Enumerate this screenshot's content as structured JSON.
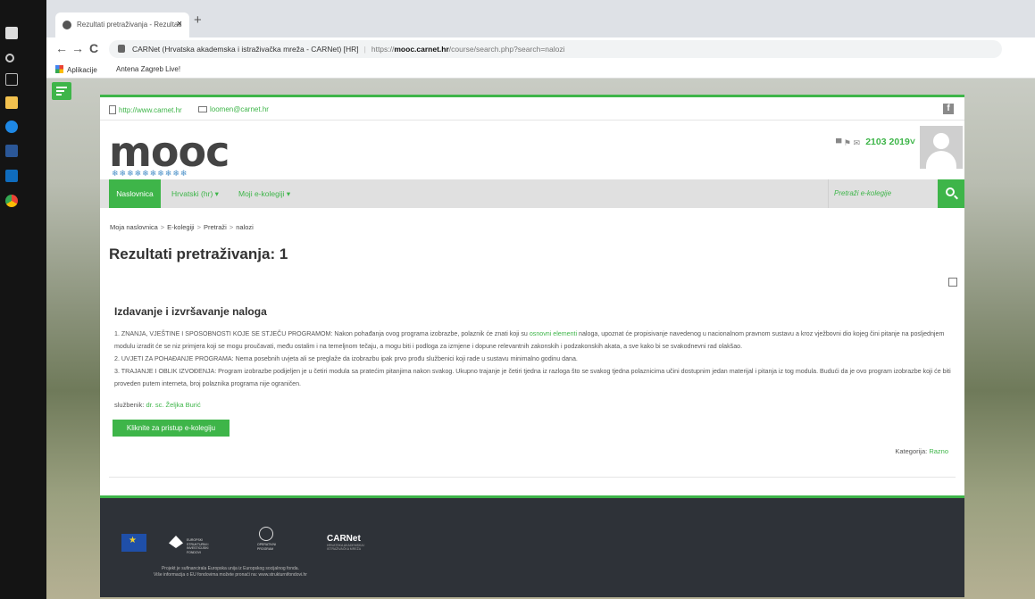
{
  "browser": {
    "tab_title": "Rezultati pretraživanja - Rezultati",
    "tab_close": "×",
    "new_tab": "+",
    "nav_back": "←",
    "nav_forward": "→",
    "nav_reload": "C",
    "site_identity": "CARNet (Hrvatska akademska i istraživačka mreža - CARNet) [HR]",
    "url_prefix": "https://",
    "url_host": "mooc.carnet.hr",
    "url_path": "/course/search.php?search=nalozi",
    "bookmarks": [
      "Aplikacije",
      "Antena Zagreb Live!"
    ]
  },
  "topbar": {
    "website": "http://www.carnet.hr",
    "email": "loomen@carnet.hr",
    "facebook_label": "f"
  },
  "logo": {
    "text": "mooc",
    "dots": "❄❄❄❄❄❄❄❄❄❄"
  },
  "user": {
    "icons": "▀  ⚑  ✉",
    "name": "2103 2019˅"
  },
  "nav": {
    "home": "Naslovnica",
    "language": "Hrvatski (hr) ▾",
    "my_courses": "Moji e-kolegiji ▾",
    "search_placeholder": "Pretraži e-kolegije"
  },
  "breadcrumb": [
    "Moja naslovnica",
    "E-kolegiji",
    "Pretraži",
    "nalozi"
  ],
  "breadcrumb_sep": ">",
  "page": {
    "heading": "Rezultati pretraživanja: 1"
  },
  "course": {
    "title": "Izdavanje i izvršavanje naloga",
    "summary_1a": "1. ZNANJA, VJEŠTINE I SPOSOBNOSTI KOJE SE STJEČU PROGRAMOM: Nakon pohađanja ovog programa izobrazbe, polaznik će znati koji su ",
    "summary_1_link": "osnovni elementi",
    "summary_1b": " naloga, upoznat će propisivanje navedenog u nacionalnom pravnom sustavu a kroz vježbovni dio kojeg čini pitanje na posljednjem modulu izradit će se niz primjera koji se mogu proučavati, među ostalim i na temeljnom tečaju, a mogu biti i podloga za izmjene i dopune relevantnih zakonskih i podzakonskih akata, a sve kako bi se svakodnevni rad olakšao.",
    "summary_2": "2. UVJETI ZA POHAĐANJE PROGRAMA: Nema posebnih uvjeta ali se preglaže da izobrazbu ipak prvo prođu službenici koji rade u sustavu minimalno godinu dana.",
    "summary_3": "3. TRAJANJE I OBLIK IZVOĐENJA: Program izobrazbe podijeljen je u četiri modula sa pratećim pitanjima nakon svakog. Ukupno trajanje je četiri tjedna iz razloga što se svakog tjedna polaznicima učini dostupnim jedan materijal i pitanja iz tog modula. Budući da je ovo program izobrazbe koji će biti proveden putem interneta, broj polaznika programa nije ograničen.",
    "teacher_label": "službenik: ",
    "teacher_name": "dr. sc. Željka Burić",
    "access_button": "Kliknite za pristup e-kolegiju",
    "category_label": "Kategorija: ",
    "category_value": "Razno"
  },
  "footer": {
    "carnet": "CARNet",
    "carnet_sub": "HRVATSKA AKADEMSKA I ISTRAŽIVAČKA MREŽA",
    "note_1": "Projekt je sufinancirala Europska unija iz Europskog socijalnog fonda.",
    "note_2": "Više informacija o EU fondovima možete pronaći na: www.strukturnifondovi.hr"
  },
  "colors": {
    "accent": "#3eb549",
    "footer_bg": "#2e3238"
  }
}
